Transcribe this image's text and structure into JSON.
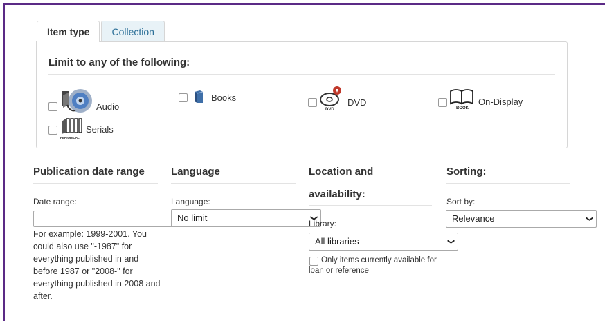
{
  "tabs": [
    {
      "label": "Item type"
    },
    {
      "label": "Collection"
    }
  ],
  "item_type_panel": {
    "heading": "Limit to any of the following:",
    "options": [
      {
        "label": "Audio",
        "icon": "audio-disc-icon"
      },
      {
        "label": "Books",
        "icon": "book-icon"
      },
      {
        "label": "DVD",
        "icon": "dvd-icon",
        "icon_caption": "DVD"
      },
      {
        "label": "On-Display",
        "icon": "open-book-icon",
        "icon_caption": "BOOK"
      },
      {
        "label": "Serials",
        "icon": "periodical-icon",
        "icon_caption": "PERIODICAL"
      }
    ]
  },
  "publication": {
    "heading": "Publication date range",
    "date_label": "Date range:",
    "date_value": "",
    "help": "For example: 1999-2001. You could also use \"-1987\" for everything published in and before 1987 or \"2008-\" for everything published in 2008 and after."
  },
  "language": {
    "heading": "Language",
    "label": "Language:",
    "selected": "No limit"
  },
  "location": {
    "heading_line1": "Location and",
    "heading_line2": "availability:",
    "library_label": "Library:",
    "library_selected": "All libraries",
    "available_label": "Only items currently available for loan or reference"
  },
  "sorting": {
    "heading": "Sorting:",
    "label": "Sort by:",
    "selected": "Relevance"
  },
  "colors": {
    "frame": "#5b2a86",
    "tab_link": "#2a6e97",
    "tab_bg": "#e8f2f7"
  }
}
